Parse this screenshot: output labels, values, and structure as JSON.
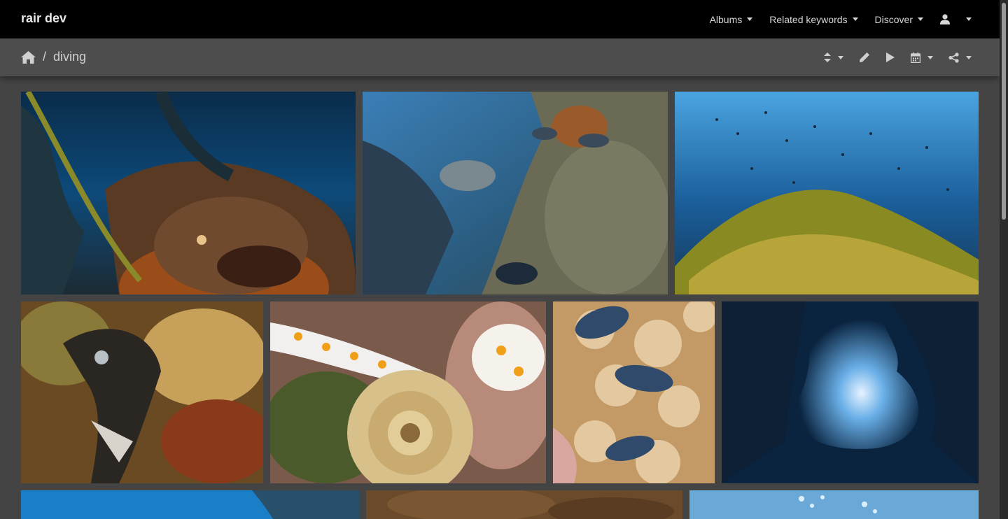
{
  "navbar": {
    "brand": "rair dev",
    "items": [
      {
        "label": "Albums"
      },
      {
        "label": "Related keywords"
      },
      {
        "label": "Discover"
      }
    ],
    "user_icon": "user-icon"
  },
  "breadcrumb": {
    "home_icon": "home-icon",
    "separator": "/",
    "current": "diving"
  },
  "toolbar": {
    "icons": [
      "sort-icon",
      "edit-icon",
      "slideshow-play-icon",
      "calendar-icon",
      "share-icon"
    ]
  },
  "gallery": {
    "photos": [
      {
        "subject": "scorpionfish in kelp"
      },
      {
        "subject": "school of fish over reef"
      },
      {
        "subject": "fish over kelp reef"
      },
      {
        "subject": "moray eel"
      },
      {
        "subject": "nudibranch with egg ribbon"
      },
      {
        "subject": "nudibranch on coral"
      },
      {
        "subject": "underwater cave"
      },
      {
        "subject": "blue water reef"
      },
      {
        "subject": "brown reef"
      },
      {
        "subject": "bubbles surface"
      }
    ]
  },
  "colors": {
    "navbar_bg": "#000000",
    "subbar_bg": "#4d4d4d",
    "page_bg": "#444444"
  }
}
